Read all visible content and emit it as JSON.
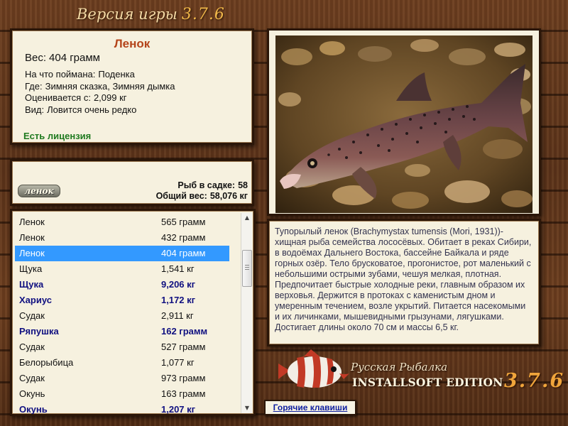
{
  "header": {
    "title": "Версия игры",
    "version": "3.7.6"
  },
  "fish_info": {
    "name": "Ленок",
    "weight_label": "Вес:",
    "weight_value": "404 грамм",
    "bait_label": "На что поймана:",
    "bait_value": "Поденка",
    "location_label": "Где:",
    "location_value": "Зимняя сказка, Зимняя дымка",
    "price_label": "Оценивается с:",
    "price_value": "2,099 кг",
    "rarity_label": "Вид:",
    "rarity_value": "Ловится очень редко",
    "license": "Есть лицензия"
  },
  "keepnet": {
    "logo_text": "ленок",
    "count_label": "Рыб в садке:",
    "count_value": "58",
    "total_label": "Общий вес:",
    "total_value": "58,076 кг"
  },
  "catch_list": [
    {
      "name": "Ленок",
      "weight": "565 грамм",
      "trophy": false,
      "selected": false
    },
    {
      "name": "Ленок",
      "weight": "432 грамм",
      "trophy": false,
      "selected": false
    },
    {
      "name": "Ленок",
      "weight": "404 грамм",
      "trophy": false,
      "selected": true
    },
    {
      "name": "Щука",
      "weight": "1,541 кг",
      "trophy": false,
      "selected": false
    },
    {
      "name": "Щука",
      "weight": "9,206 кг",
      "trophy": true,
      "selected": false
    },
    {
      "name": "Хариус",
      "weight": "1,172 кг",
      "trophy": true,
      "selected": false
    },
    {
      "name": "Судак",
      "weight": "2,911 кг",
      "trophy": false,
      "selected": false
    },
    {
      "name": "Ряпушка",
      "weight": "162 грамм",
      "trophy": true,
      "selected": false
    },
    {
      "name": "Судак",
      "weight": "527 грамм",
      "trophy": false,
      "selected": false
    },
    {
      "name": "Белорыбица",
      "weight": "1,077 кг",
      "trophy": false,
      "selected": false
    },
    {
      "name": "Судак",
      "weight": "973 грамм",
      "trophy": false,
      "selected": false
    },
    {
      "name": "Окунь",
      "weight": "163 грамм",
      "trophy": false,
      "selected": false
    },
    {
      "name": "Окунь",
      "weight": "1,207 кг",
      "trophy": true,
      "selected": false
    }
  ],
  "description": "Тупорылый ленок (Brachymystax tumensis (Mori, 1931))- хищная рыба семейства лососёвых. Обитает в реках Сибири, в водоёмах Дальнего Востока, бассейне Байкала и ряде горных озёр. Тело брусковатое, прогонистое, рот маленький с небольшими острыми зубами, чешуя мелкая, плотная. Предпочитает быстрые холодные реки, главным образом их верховья. Держится в протоках с каменистым дном и умеренным течением, возле укрытий. Питается насекомыми и их личинками, мышевидными грызунами, лягушками. Достигает длины около 70 см и массы 6,5 кг.",
  "brand": {
    "line1": "Русская Рыбалка",
    "line2": "INSTALLSOFT EDITION",
    "version": "3.7.6"
  },
  "buttons": {
    "hotkeys": "Горячие клавиши"
  },
  "colors": {
    "wood": "#5a3219",
    "panel": "#f6f1df",
    "selection": "#3399ff",
    "trophy_text": "#101080",
    "fish_name": "#b4441a",
    "license": "#1f7a1f"
  }
}
